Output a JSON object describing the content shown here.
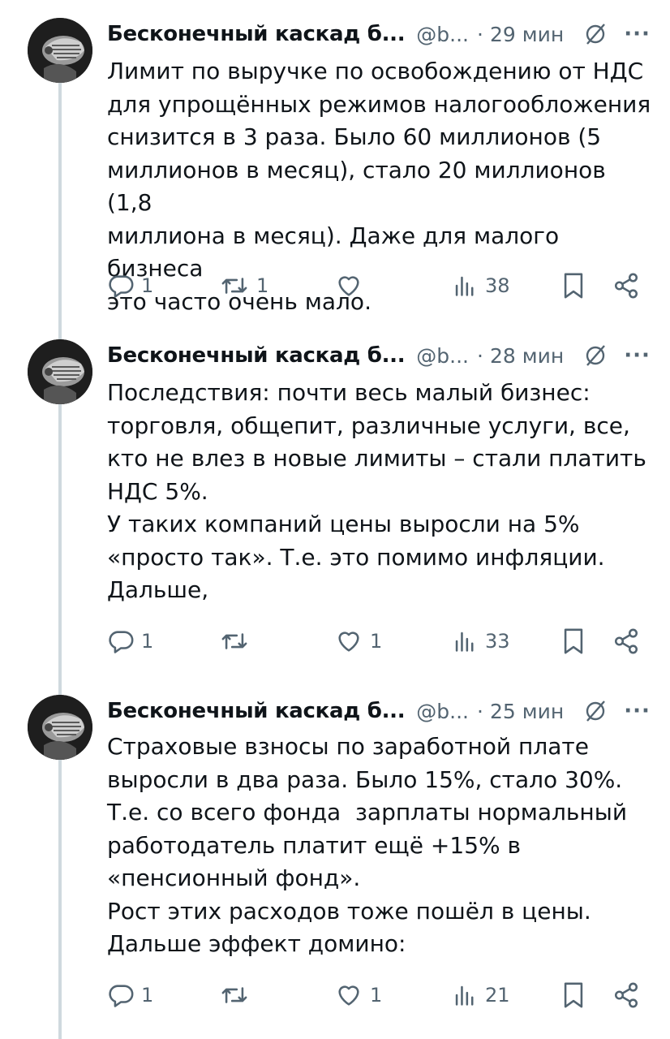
{
  "tweets": [
    {
      "author": "Бесконечный каскад б...",
      "handle": "@b...",
      "sep": "·",
      "time": "29 мин",
      "more": "···",
      "text": "Лимит по выручке по освобождению от НДС\nдля упрощённых режимов налогообложения\nснизится в 3 раза. Было 60 миллионов (5\nмиллионов в месяц), стало 20 миллионов (1,8\nмиллиона в месяц). Даже для малого бизнеса\nэто часто очень мало.",
      "replies": "1",
      "retweets": "1",
      "likes": "",
      "views": "38"
    },
    {
      "author": "Бесконечный каскад б...",
      "handle": "@b...",
      "sep": "·",
      "time": "28 мин",
      "more": "···",
      "text": "Последствия: почти весь малый бизнес:\nторговля, общепит, различные услуги, все,\nкто не влез в новые лимиты – стали платить\nНДС 5%.\nУ таких компаний цены выросли на 5%\n«просто так». Т.е. это помимо инфляции.\nДальше,",
      "replies": "1",
      "retweets": "",
      "likes": "1",
      "views": "33"
    },
    {
      "author": "Бесконечный каскад б...",
      "handle": "@b...",
      "sep": "·",
      "time": "25 мин",
      "more": "···",
      "text": "Страховые взносы по заработной плате\nвыросли в два раза. Было 15%, стало 30%.\nТ.е. со всего фонда  зарплаты нормальный\nработодатель платит ещё +15% в\n«пенсионный фонд».\nРост этих расходов тоже пошёл в цены.\nДальше эффект домино:",
      "replies": "1",
      "retweets": "",
      "likes": "1",
      "views": "21"
    }
  ],
  "icons": {
    "reply": "reply-icon",
    "retweet": "retweet-icon",
    "like": "heart-icon",
    "views": "views-icon",
    "bookmark": "bookmark-icon",
    "share": "share-icon",
    "grok": "grok-icon"
  },
  "colors": {
    "text": "#0f1419",
    "secondary": "#536471",
    "thread_line": "#cfd9de"
  }
}
